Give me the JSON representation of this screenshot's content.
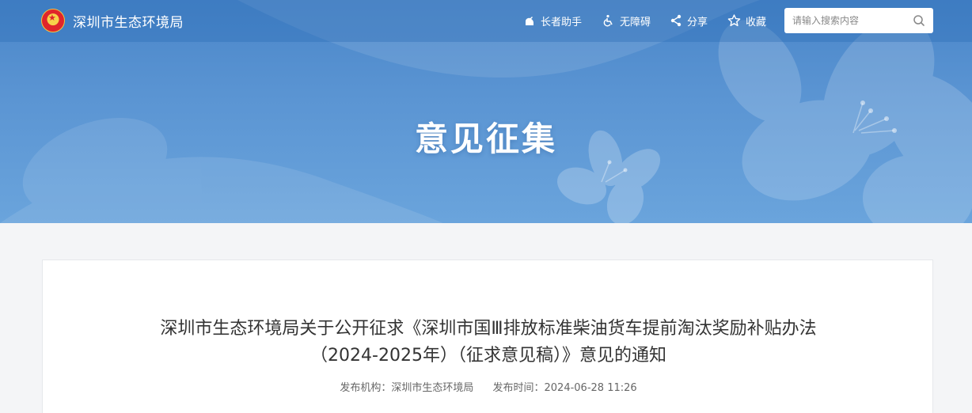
{
  "header": {
    "site_name": "深圳市生态环境局",
    "tools": [
      {
        "label": "长者助手",
        "icon": "elderly-assist-icon"
      },
      {
        "label": "无障碍",
        "icon": "accessibility-icon"
      },
      {
        "label": "分享",
        "icon": "share-icon"
      },
      {
        "label": "收藏",
        "icon": "star-icon"
      }
    ],
    "search": {
      "placeholder": "请输入搜索内容",
      "icon": "search-icon"
    }
  },
  "banner": {
    "title": "意见征集"
  },
  "article": {
    "title_line1": "深圳市生态环境局关于公开征求《深圳市国Ⅲ排放标准柴油货车提前淘汰奖励补贴办法",
    "title_line2": "（2024-2025年）（征求意见稿）》意见的通知",
    "publisher_label": "发布机构：",
    "publisher": "深圳市生态环境局",
    "time_label": "发布时间：",
    "time": "2024-06-28 11:26"
  },
  "colors": {
    "banner_top": "#4a86c9",
    "banner_bottom": "#6aa4dc",
    "page_bg": "#f4f5f7",
    "title_text": "#333333"
  }
}
